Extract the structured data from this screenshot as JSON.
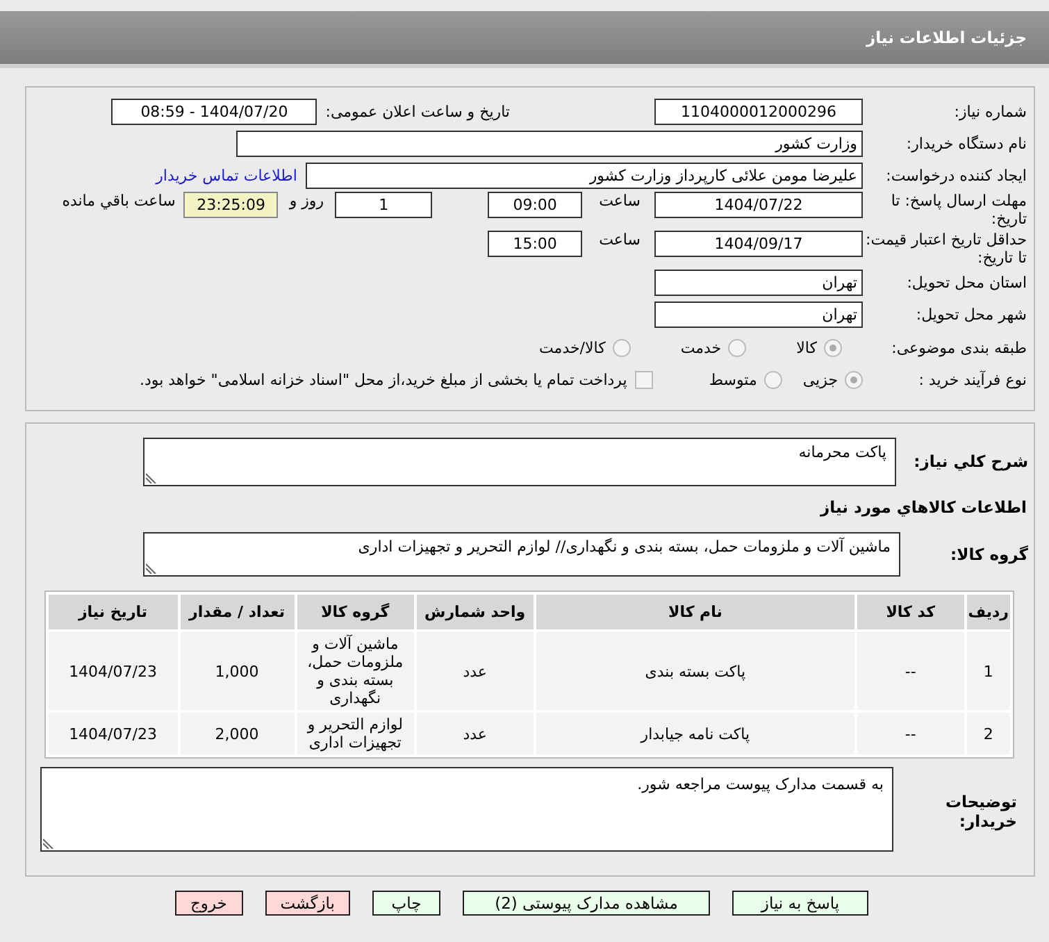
{
  "header": {
    "title": "جزئیات اطلاعات نیاز"
  },
  "info": {
    "need_number": {
      "label": "شماره نیاز:",
      "value": "1104000012000296"
    },
    "announce": {
      "label": "تاریخ و ساعت اعلان عمومی:",
      "value": "1404/07/20 - 08:59"
    },
    "buyer": {
      "label": "نام دستگاه خریدار:",
      "value": "وزارت کشور"
    },
    "creator": {
      "label": "ایجاد کننده درخواست:",
      "value": "علیرضا مومن علائی کارپرداز وزارت کشور",
      "link": "اطلاعات تماس خریدار"
    },
    "deadline": {
      "label": "مهلت ارسال پاسخ: تا تاریخ:",
      "date": "1404/07/22",
      "time_label": "ساعت",
      "time": "09:00",
      "days": "1",
      "days_label": "روز و",
      "remaining": "23:25:09",
      "remaining_label": "ساعت باقي مانده"
    },
    "validity": {
      "label": "حداقل تاریخ اعتبار قیمت: تا تاریخ:",
      "date": "1404/09/17",
      "time_label": "ساعت",
      "time": "15:00"
    },
    "province": {
      "label": "استان محل تحویل:",
      "value": "تهران"
    },
    "city": {
      "label": "شهر محل تحویل:",
      "value": "تهران"
    },
    "category": {
      "label": "طبقه بندی موضوعی:",
      "options": [
        {
          "label": "کالا",
          "selected": true
        },
        {
          "label": "خدمت",
          "selected": false
        },
        {
          "label": "کالا/خدمت",
          "selected": false
        }
      ]
    },
    "process": {
      "label": "نوع فرآیند خرید :",
      "options": [
        {
          "label": "جزیی",
          "selected": true
        },
        {
          "label": "متوسط",
          "selected": false
        }
      ],
      "treasury": {
        "label": "پرداخت تمام یا بخشی از مبلغ خرید،از محل \"اسناد خزانه اسلامی\" خواهد بود.",
        "checked": false
      }
    }
  },
  "goods": {
    "description": {
      "label": "شرح کلي نیاز:",
      "value": "پاکت محرمانه"
    },
    "heading": "اطلاعات کالاهاي مورد نیاز",
    "group": {
      "label": "گروه کالا:",
      "value": "ماشین آلات و ملزومات حمل، بسته بندی و نگهداری// لوازم التحریر و تجهیزات اداری"
    },
    "table": {
      "columns": [
        "ردیف",
        "کد کالا",
        "نام کالا",
        "واحد شمارش",
        "گروه کالا",
        "تعداد / مقدار",
        "تاریخ نیاز"
      ],
      "rows": [
        [
          "1",
          "--",
          "پاکت بسته بندی",
          "عدد",
          "ماشین آلات و ملزومات حمل، بسته بندی و نگهداری",
          "1,000",
          "1404/07/23"
        ],
        [
          "2",
          "--",
          "پاکت نامه جیابدار",
          "عدد",
          "لوازم التحریر و تجهیزات اداری",
          "2,000",
          "1404/07/23"
        ]
      ]
    },
    "notes": {
      "label": "توضیحات خریدار:",
      "value": "به قسمت مدارک پیوست مراجعه شور."
    }
  },
  "actions": [
    {
      "label": "پاسخ به نیاز",
      "kind": "normal"
    },
    {
      "label": "مشاهده مدارک پیوستی (2)",
      "kind": "normal"
    },
    {
      "label": "چاپ",
      "kind": "normal"
    },
    {
      "label": "بازگشت",
      "kind": "danger"
    },
    {
      "label": "خروج",
      "kind": "danger"
    }
  ]
}
